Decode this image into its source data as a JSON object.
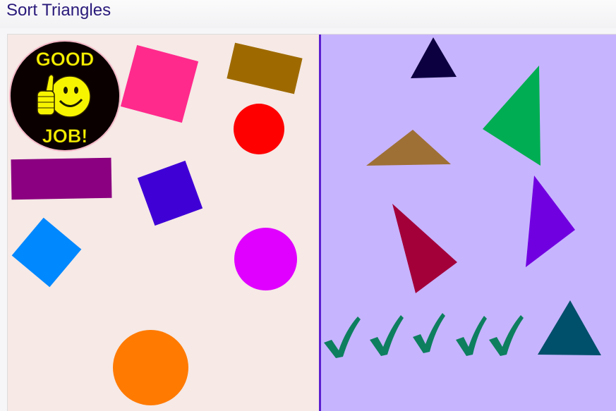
{
  "app": {
    "title": "Sort Triangles"
  },
  "badge": {
    "top_text": "GOOD",
    "bottom_text": "JOB!",
    "icon": "thumbs-up-smiley-icon"
  },
  "colors": {
    "left_zone": "#f6e9e6",
    "right_zone": "#c7b4ff",
    "divider": "#5b1fd0",
    "check": "#0d7f5f"
  },
  "left_zone_shapes": [
    {
      "kind": "square",
      "color": "#ff2a8c"
    },
    {
      "kind": "rectangle",
      "color": "#9e6a00"
    },
    {
      "kind": "circle",
      "color": "#ff0000"
    },
    {
      "kind": "rectangle",
      "color": "#8b0080"
    },
    {
      "kind": "square",
      "color": "#3f00d6"
    },
    {
      "kind": "square",
      "color": "#0088ff"
    },
    {
      "kind": "circle",
      "color": "#e000ff"
    },
    {
      "kind": "circle",
      "color": "#ff7a00"
    }
  ],
  "right_zone_shapes": [
    {
      "kind": "triangle",
      "color": "#0c0040"
    },
    {
      "kind": "triangle",
      "color": "#00ad52"
    },
    {
      "kind": "triangle",
      "color": "#9e7035"
    },
    {
      "kind": "triangle",
      "color": "#a3003a"
    },
    {
      "kind": "triangle",
      "color": "#7100e0"
    },
    {
      "kind": "triangle",
      "color": "#004f6b"
    }
  ],
  "progress": {
    "correct_count": 5,
    "icon": "checkmark-icon"
  }
}
